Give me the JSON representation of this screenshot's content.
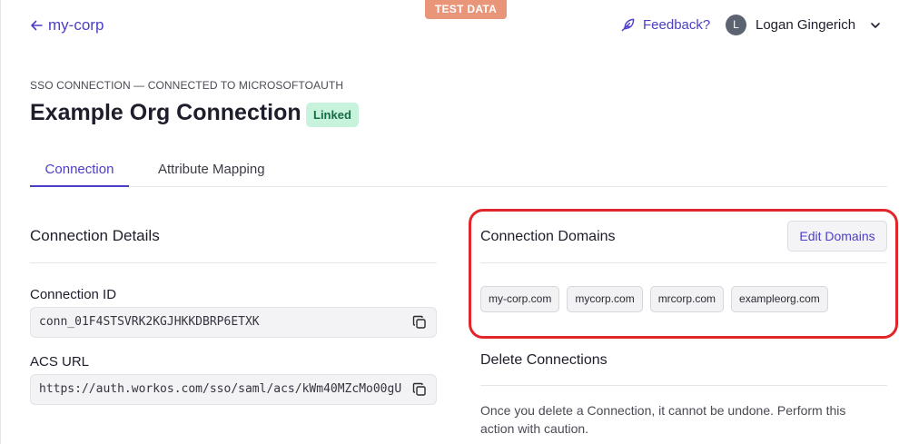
{
  "banner": {
    "label": "TEST DATA",
    "color": "#e9957a"
  },
  "header": {
    "back_label": "my-corp",
    "back_icon": "arrow-left-icon",
    "feedback_label": "Feedback?",
    "feedback_icon": "feather-icon",
    "user": {
      "initial": "L",
      "name": "Logan Gingerich",
      "menu_icon": "chevron-down-icon"
    }
  },
  "page": {
    "eyebrow": "SSO CONNECTION — CONNECTED TO MICROSOFTOAUTH",
    "title": "Example Org Connection",
    "status_badge": "Linked"
  },
  "tabs": [
    {
      "label": "Connection",
      "active": true
    },
    {
      "label": "Attribute Mapping",
      "active": false
    }
  ],
  "details": {
    "title": "Connection Details",
    "fields": [
      {
        "label": "Connection ID",
        "value": "conn_01F4STSVRK2KGJHKKDBRP6ETXK",
        "copy_icon": "copy-icon"
      },
      {
        "label": "ACS URL",
        "value": "https://auth.workos.com/sso/saml/acs/kWm40MZcMo00gU(",
        "copy_icon": "copy-icon"
      }
    ]
  },
  "domains": {
    "title": "Connection Domains",
    "edit_label": "Edit Domains",
    "items": [
      "my-corp.com",
      "mycorp.com",
      "mrcorp.com",
      "exampleorg.com"
    ],
    "highlight_color": "#e0262a"
  },
  "delete": {
    "title": "Delete Connections",
    "description": "Once you delete a Connection, it cannot be undone. Perform this action with caution."
  },
  "colors": {
    "accent": "#4b3fc7",
    "badge_bg": "#c7f2dc",
    "badge_text": "#176b42"
  }
}
